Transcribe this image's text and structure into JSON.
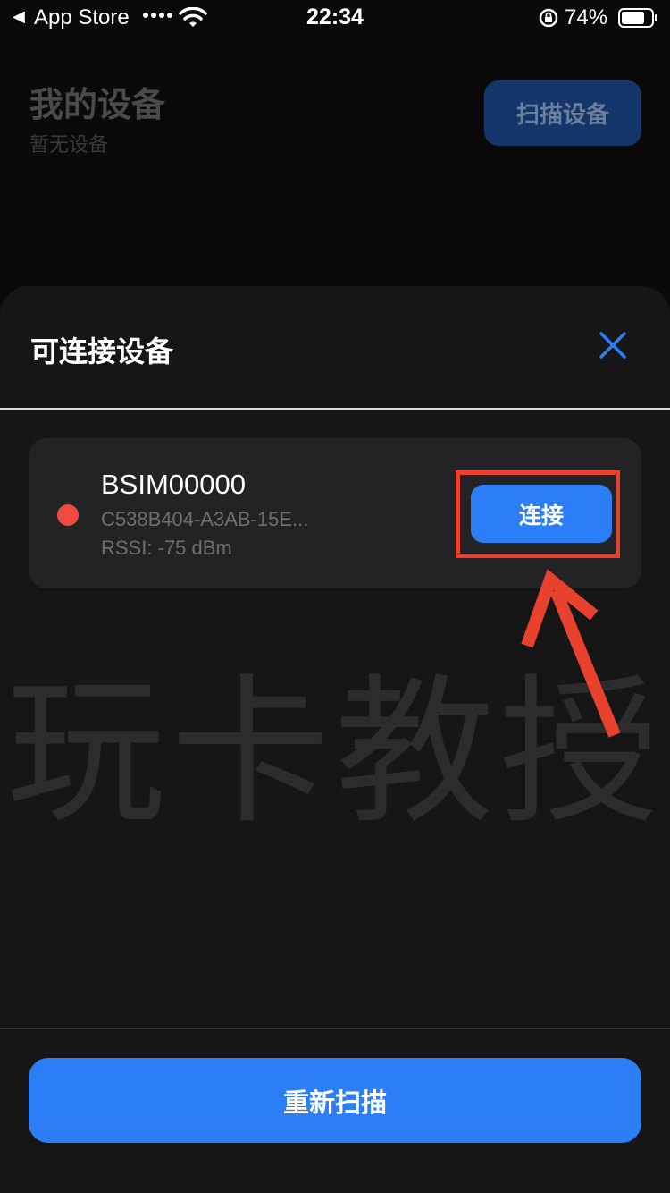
{
  "status_bar": {
    "back_label": "App Store",
    "time": "22:34",
    "battery_percent": "74%"
  },
  "background_page": {
    "title": "我的设备",
    "subtitle": "暂无设备",
    "scan_button_label": "扫描设备"
  },
  "sheet": {
    "title": "可连接设备",
    "devices": [
      {
        "name": "BSIM00000",
        "uuid": "C538B404-A3AB-15E...",
        "rssi": "RSSI: -75 dBm",
        "status_color": "#f04a42",
        "connect_label": "连接"
      }
    ],
    "rescan_label": "重新扫描"
  },
  "watermark_text": "玩卡教授",
  "colors": {
    "accent": "#2b7ef6",
    "highlight": "#e8412e",
    "sheet_bg": "#161617",
    "card_bg": "#232325"
  }
}
